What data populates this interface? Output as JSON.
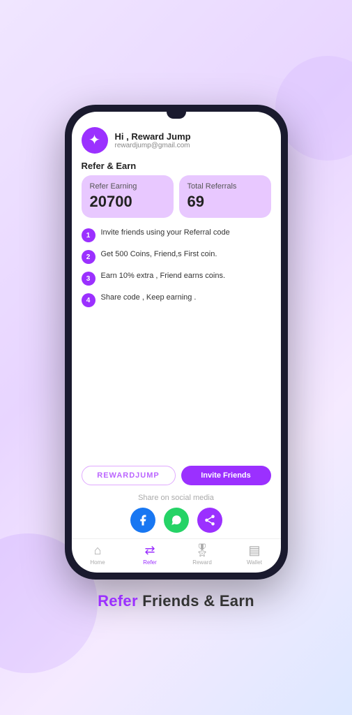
{
  "header": {
    "greeting": "Hi , Reward Jump",
    "email": "rewardjump@gmail.com"
  },
  "section": {
    "title": "Refer & Earn"
  },
  "stats": {
    "card1": {
      "label": "Refer Earning",
      "value": "20700"
    },
    "card2": {
      "label": "Total Referrals",
      "value": "69"
    }
  },
  "steps": [
    {
      "num": "1",
      "text": "Invite friends using your Referral code"
    },
    {
      "num": "2",
      "text": "Get 500 Coins, Friend,s First coin."
    },
    {
      "num": "3",
      "text": "Earn 10% extra , Friend earns coins."
    },
    {
      "num": "4",
      "text": "Share code , Keep earning ."
    }
  ],
  "referral": {
    "code": "REWARDJUMP",
    "invite_label": "Invite Friends"
  },
  "social": {
    "label": "Share on social media",
    "facebook_icon": "f",
    "whatsapp_icon": "w",
    "share_icon": "⋯"
  },
  "nav": [
    {
      "label": "Home",
      "icon": "⌂",
      "active": false
    },
    {
      "label": "Refer",
      "icon": "⇄",
      "active": true
    },
    {
      "label": "Reward",
      "icon": "🎖",
      "active": false
    },
    {
      "label": "Wallet",
      "icon": "▤",
      "active": false
    }
  ],
  "tagline": {
    "highlight": "Refer",
    "rest": " Friends & Earn"
  }
}
